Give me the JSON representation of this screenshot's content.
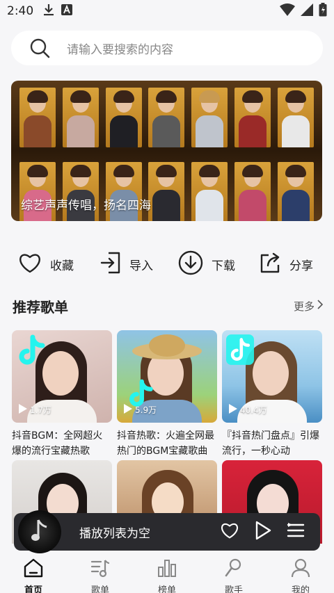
{
  "status_bar": {
    "time": "2:40"
  },
  "search": {
    "placeholder": "请输入要搜索的内容"
  },
  "banner": {
    "caption": "综艺声声传唱，扬名四海"
  },
  "actions": [
    {
      "label": "收藏",
      "icon": "heart-icon"
    },
    {
      "label": "导入",
      "icon": "import-icon"
    },
    {
      "label": "下载",
      "icon": "download-icon"
    },
    {
      "label": "分享",
      "icon": "share-icon"
    }
  ],
  "section": {
    "title": "推荐歌单",
    "more_label": "更多"
  },
  "playlists": [
    {
      "title": "抖音BGM：全网超火爆的流行宝藏热歌",
      "play_count": "1.7万"
    },
    {
      "title": "抖音热歌：火遍全网最热门的BGM宝藏歌曲",
      "play_count": "5.9万"
    },
    {
      "title": "『抖音热门盘点』引爆流行，一秒心动",
      "play_count": "40.4万"
    }
  ],
  "mini_player": {
    "title": "播放列表为空"
  },
  "tabs": [
    {
      "label": "首页",
      "icon": "home-icon",
      "active": true
    },
    {
      "label": "歌单",
      "icon": "playlist-icon"
    },
    {
      "label": "榜单",
      "icon": "chart-icon"
    },
    {
      "label": "歌手",
      "icon": "singer-icon"
    },
    {
      "label": "我的",
      "icon": "user-icon"
    }
  ],
  "colors": {
    "background": "#f6f6f8",
    "mini_player": "#2a2a2e",
    "banner_gold": "#d9a23b"
  }
}
